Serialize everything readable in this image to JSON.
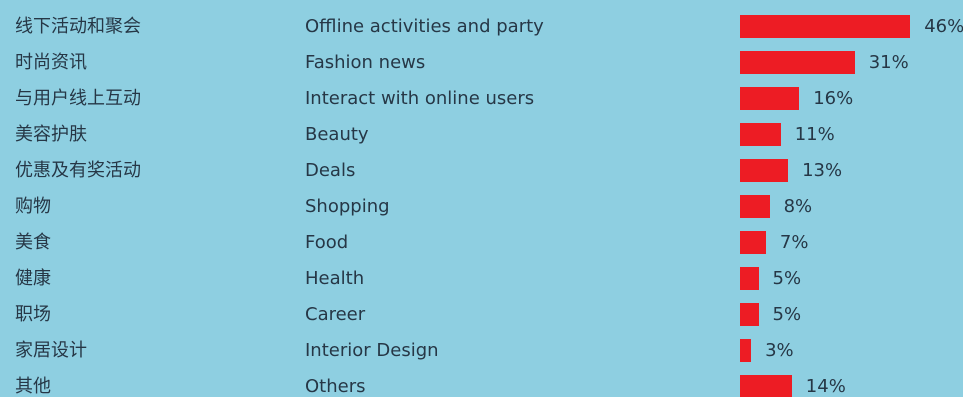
{
  "chart_data": {
    "type": "bar",
    "orientation": "horizontal",
    "unit": "%",
    "categories_cn": [
      "线下活动和聚会",
      "时尚资讯",
      "与用户线上互动",
      "美容护肤",
      "优惠及有奖活动",
      "购物",
      "美食",
      "健康",
      "职场",
      "家居设计",
      "其他"
    ],
    "categories": [
      "Offline activities and party",
      "Fashion news",
      "Interact with online users",
      "Beauty",
      "Deals",
      "Shopping",
      "Food",
      "Health",
      "Career",
      "Interior Design",
      "Others"
    ],
    "values": [
      46,
      31,
      16,
      11,
      13,
      8,
      7,
      5,
      5,
      3,
      14
    ],
    "value_labels": [
      "46%",
      "31%",
      "16%",
      "11%",
      "13%",
      "8%",
      "7%",
      "5%",
      "5%",
      "3%",
      "14%"
    ],
    "colors": {
      "background": "#8ecfe1",
      "bar": "#ed1c24",
      "text": "#263746"
    }
  }
}
